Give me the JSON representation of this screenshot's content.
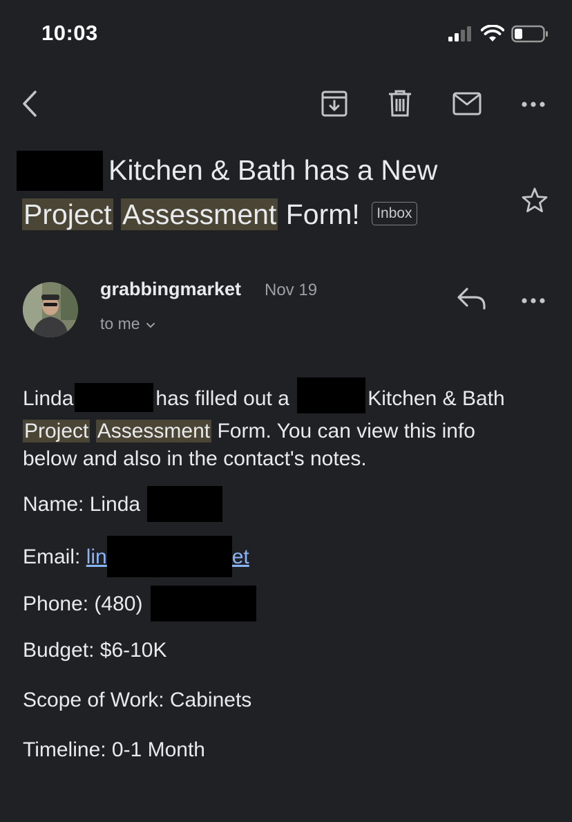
{
  "status": {
    "time": "10:03"
  },
  "toolbar": {
    "back_icon": "chevron-left-icon",
    "archive_icon": "archive-icon",
    "delete_icon": "trash-icon",
    "mark_unread_icon": "mail-icon",
    "more_icon": "more-horizontal-icon"
  },
  "subject": {
    "part1": "Kitchen & Bath has a New",
    "word_project": "Project",
    "word_assessment": "Assessment",
    "part_form": "Form!",
    "label": "Inbox"
  },
  "sender": {
    "name": "grabbingmarket",
    "date": "Nov 19",
    "recipient": "to me"
  },
  "message": {
    "intro_name": "Linda",
    "intro_filled": "has filled out a",
    "intro_kb": "Kitchen & Bath",
    "word_project": "Project",
    "word_assessment": "Assessment",
    "intro_rest": "Form. You can view this info",
    "intro_line3": "below and also in the contact's notes.",
    "name_label": "Name: Linda",
    "email_label": "Email:",
    "email_start": "lin",
    "email_end": "et",
    "phone_label": "Phone: (480)",
    "budget": "Budget: $6-10K",
    "scope": "Scope of Work: Cabinets",
    "timeline": "Timeline: 0-1 Month"
  },
  "colors": {
    "background": "#202124",
    "highlight": "#4a4535",
    "link": "#8ab4f8"
  }
}
